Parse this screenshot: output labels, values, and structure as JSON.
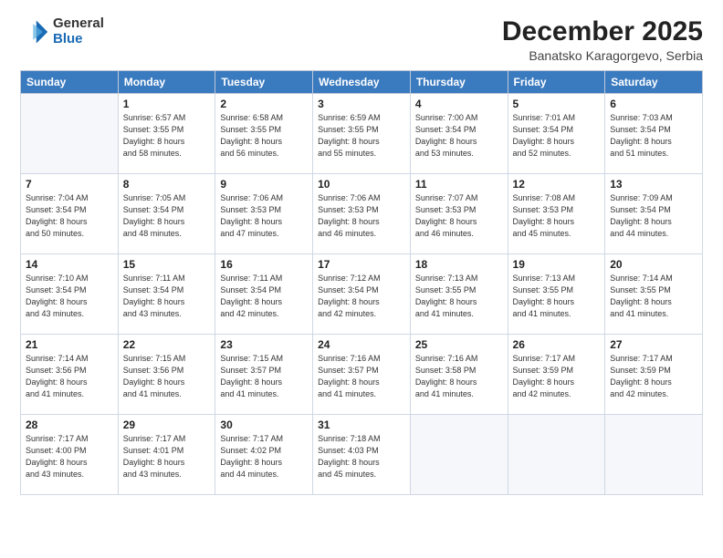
{
  "logo": {
    "general": "General",
    "blue": "Blue"
  },
  "calendar": {
    "title": "December 2025",
    "subtitle": "Banatsko Karagorgevo, Serbia",
    "days_of_week": [
      "Sunday",
      "Monday",
      "Tuesday",
      "Wednesday",
      "Thursday",
      "Friday",
      "Saturday"
    ],
    "weeks": [
      [
        {
          "day": "",
          "info": ""
        },
        {
          "day": "1",
          "info": "Sunrise: 6:57 AM\nSunset: 3:55 PM\nDaylight: 8 hours\nand 58 minutes."
        },
        {
          "day": "2",
          "info": "Sunrise: 6:58 AM\nSunset: 3:55 PM\nDaylight: 8 hours\nand 56 minutes."
        },
        {
          "day": "3",
          "info": "Sunrise: 6:59 AM\nSunset: 3:55 PM\nDaylight: 8 hours\nand 55 minutes."
        },
        {
          "day": "4",
          "info": "Sunrise: 7:00 AM\nSunset: 3:54 PM\nDaylight: 8 hours\nand 53 minutes."
        },
        {
          "day": "5",
          "info": "Sunrise: 7:01 AM\nSunset: 3:54 PM\nDaylight: 8 hours\nand 52 minutes."
        },
        {
          "day": "6",
          "info": "Sunrise: 7:03 AM\nSunset: 3:54 PM\nDaylight: 8 hours\nand 51 minutes."
        }
      ],
      [
        {
          "day": "7",
          "info": "Sunrise: 7:04 AM\nSunset: 3:54 PM\nDaylight: 8 hours\nand 50 minutes."
        },
        {
          "day": "8",
          "info": "Sunrise: 7:05 AM\nSunset: 3:54 PM\nDaylight: 8 hours\nand 48 minutes."
        },
        {
          "day": "9",
          "info": "Sunrise: 7:06 AM\nSunset: 3:53 PM\nDaylight: 8 hours\nand 47 minutes."
        },
        {
          "day": "10",
          "info": "Sunrise: 7:06 AM\nSunset: 3:53 PM\nDaylight: 8 hours\nand 46 minutes."
        },
        {
          "day": "11",
          "info": "Sunrise: 7:07 AM\nSunset: 3:53 PM\nDaylight: 8 hours\nand 46 minutes."
        },
        {
          "day": "12",
          "info": "Sunrise: 7:08 AM\nSunset: 3:53 PM\nDaylight: 8 hours\nand 45 minutes."
        },
        {
          "day": "13",
          "info": "Sunrise: 7:09 AM\nSunset: 3:54 PM\nDaylight: 8 hours\nand 44 minutes."
        }
      ],
      [
        {
          "day": "14",
          "info": "Sunrise: 7:10 AM\nSunset: 3:54 PM\nDaylight: 8 hours\nand 43 minutes."
        },
        {
          "day": "15",
          "info": "Sunrise: 7:11 AM\nSunset: 3:54 PM\nDaylight: 8 hours\nand 43 minutes."
        },
        {
          "day": "16",
          "info": "Sunrise: 7:11 AM\nSunset: 3:54 PM\nDaylight: 8 hours\nand 42 minutes."
        },
        {
          "day": "17",
          "info": "Sunrise: 7:12 AM\nSunset: 3:54 PM\nDaylight: 8 hours\nand 42 minutes."
        },
        {
          "day": "18",
          "info": "Sunrise: 7:13 AM\nSunset: 3:55 PM\nDaylight: 8 hours\nand 41 minutes."
        },
        {
          "day": "19",
          "info": "Sunrise: 7:13 AM\nSunset: 3:55 PM\nDaylight: 8 hours\nand 41 minutes."
        },
        {
          "day": "20",
          "info": "Sunrise: 7:14 AM\nSunset: 3:55 PM\nDaylight: 8 hours\nand 41 minutes."
        }
      ],
      [
        {
          "day": "21",
          "info": "Sunrise: 7:14 AM\nSunset: 3:56 PM\nDaylight: 8 hours\nand 41 minutes."
        },
        {
          "day": "22",
          "info": "Sunrise: 7:15 AM\nSunset: 3:56 PM\nDaylight: 8 hours\nand 41 minutes."
        },
        {
          "day": "23",
          "info": "Sunrise: 7:15 AM\nSunset: 3:57 PM\nDaylight: 8 hours\nand 41 minutes."
        },
        {
          "day": "24",
          "info": "Sunrise: 7:16 AM\nSunset: 3:57 PM\nDaylight: 8 hours\nand 41 minutes."
        },
        {
          "day": "25",
          "info": "Sunrise: 7:16 AM\nSunset: 3:58 PM\nDaylight: 8 hours\nand 41 minutes."
        },
        {
          "day": "26",
          "info": "Sunrise: 7:17 AM\nSunset: 3:59 PM\nDaylight: 8 hours\nand 42 minutes."
        },
        {
          "day": "27",
          "info": "Sunrise: 7:17 AM\nSunset: 3:59 PM\nDaylight: 8 hours\nand 42 minutes."
        }
      ],
      [
        {
          "day": "28",
          "info": "Sunrise: 7:17 AM\nSunset: 4:00 PM\nDaylight: 8 hours\nand 43 minutes."
        },
        {
          "day": "29",
          "info": "Sunrise: 7:17 AM\nSunset: 4:01 PM\nDaylight: 8 hours\nand 43 minutes."
        },
        {
          "day": "30",
          "info": "Sunrise: 7:17 AM\nSunset: 4:02 PM\nDaylight: 8 hours\nand 44 minutes."
        },
        {
          "day": "31",
          "info": "Sunrise: 7:18 AM\nSunset: 4:03 PM\nDaylight: 8 hours\nand 45 minutes."
        },
        {
          "day": "",
          "info": ""
        },
        {
          "day": "",
          "info": ""
        },
        {
          "day": "",
          "info": ""
        }
      ]
    ]
  }
}
